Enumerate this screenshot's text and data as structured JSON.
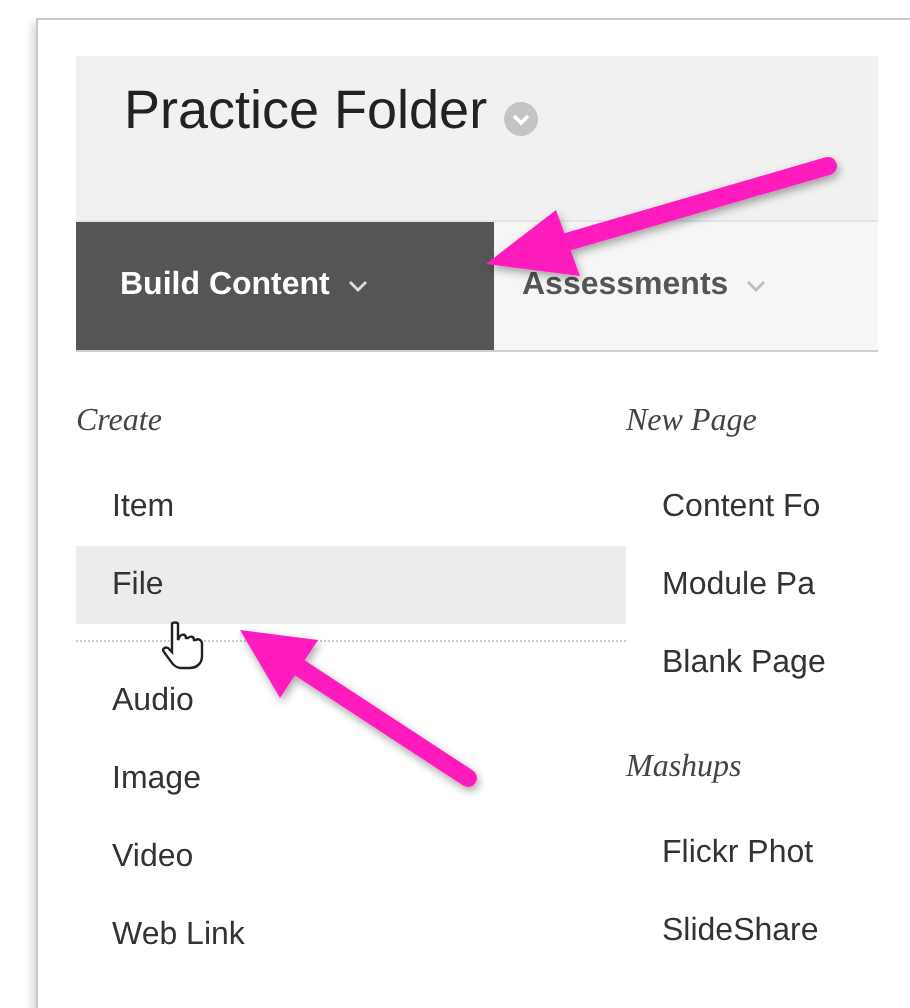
{
  "page": {
    "title": "Practice Folder"
  },
  "tabs": [
    {
      "label": "Build Content",
      "selected": true
    },
    {
      "label": "Assessments",
      "selected": false
    }
  ],
  "menu": {
    "columns": [
      {
        "sections": [
          {
            "heading": "Create",
            "groups": [
              [
                {
                  "label": "Item",
                  "highlighted": false
                },
                {
                  "label": "File",
                  "highlighted": true
                }
              ],
              [
                {
                  "label": "Audio",
                  "highlighted": false
                },
                {
                  "label": "Image",
                  "highlighted": false
                },
                {
                  "label": "Video",
                  "highlighted": false
                },
                {
                  "label": "Web Link",
                  "highlighted": false
                }
              ]
            ]
          }
        ]
      },
      {
        "sections": [
          {
            "heading": "New Page",
            "groups": [
              [
                {
                  "label": "Content Fo",
                  "highlighted": false
                },
                {
                  "label": "Module Pa",
                  "highlighted": false
                },
                {
                  "label": "Blank Page",
                  "highlighted": false
                }
              ]
            ]
          },
          {
            "heading": "Mashups",
            "groups": [
              [
                {
                  "label": "Flickr Phot",
                  "highlighted": false
                },
                {
                  "label": "SlideShare",
                  "highlighted": false
                }
              ]
            ]
          }
        ]
      }
    ]
  }
}
